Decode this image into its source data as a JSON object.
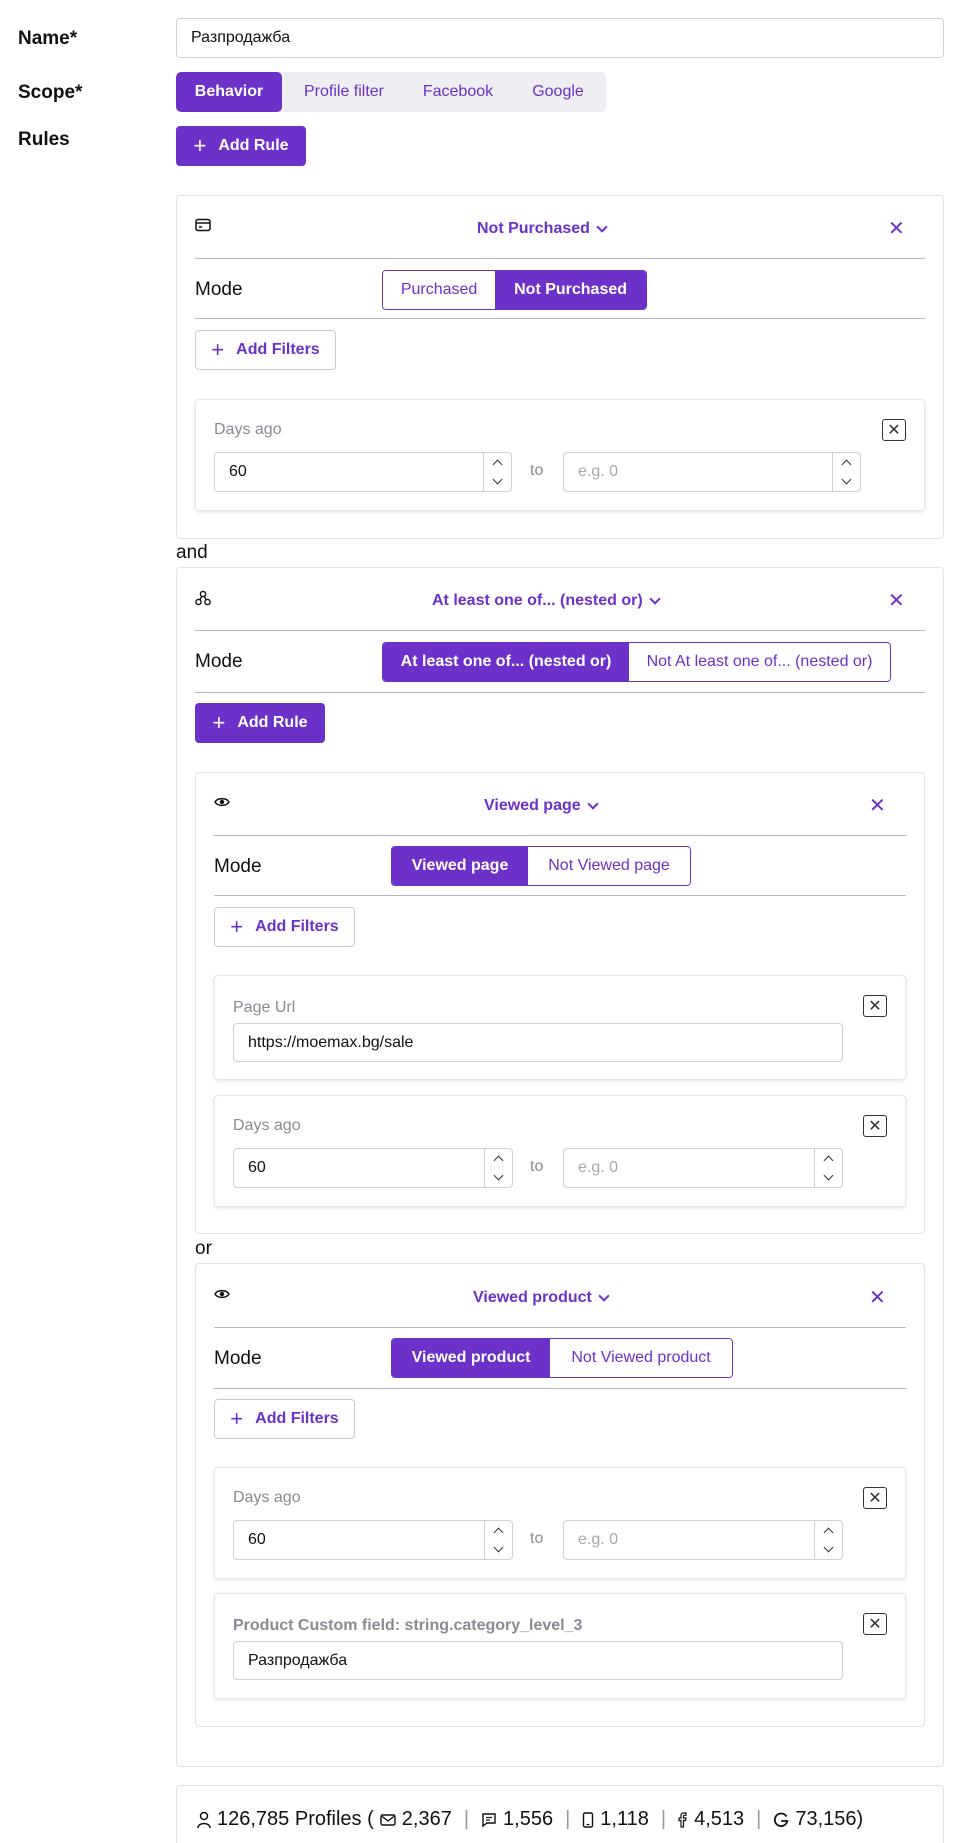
{
  "form": {
    "name_label": "Name*",
    "name_value": "Разпродажба",
    "scope_label": "Scope*",
    "scope_tabs": [
      "Behavior",
      "Profile filter",
      "Facebook",
      "Google"
    ],
    "scope_active": "Behavior",
    "rules_label": "Rules",
    "add_rule_label": "Add Rule"
  },
  "rule1": {
    "icon": "credit-card-icon",
    "title": "Not Purchased",
    "mode_label": "Mode",
    "mode_options": [
      "Purchased",
      "Not Purchased"
    ],
    "mode_active": "Not Purchased",
    "add_filters_label": "Add Filters",
    "filter_days": {
      "label": "Days ago",
      "from": "60",
      "to_label": "to",
      "to_placeholder": "e.g. 0"
    }
  },
  "joiner_and": "and",
  "rule2": {
    "icon": "nodes-icon",
    "title": "At least one of... (nested or)",
    "mode_label": "Mode",
    "mode_options": [
      "At least one of... (nested or)",
      "Not At least one of... (nested or)"
    ],
    "mode_active": "At least one of... (nested or)",
    "add_rule_label": "Add Rule",
    "nested": [
      {
        "icon": "eye-icon",
        "title": "Viewed page",
        "mode_label": "Mode",
        "mode_options": [
          "Viewed page",
          "Not Viewed page"
        ],
        "mode_active": "Viewed page",
        "add_filters_label": "Add Filters",
        "filter_url": {
          "label": "Page Url",
          "value": "https://moemax.bg/sale"
        },
        "filter_days": {
          "label": "Days ago",
          "from": "60",
          "to_label": "to",
          "to_placeholder": "e.g. 0"
        }
      },
      {
        "icon": "eye-icon",
        "title": "Viewed product",
        "mode_label": "Mode",
        "mode_options": [
          "Viewed product",
          "Not Viewed product"
        ],
        "mode_active": "Viewed product",
        "add_filters_label": "Add Filters",
        "filter_days": {
          "label": "Days ago",
          "from": "60",
          "to_label": "to",
          "to_placeholder": "e.g. 0"
        },
        "filter_custom": {
          "label": "Product Custom field: string.category_level_3",
          "value": "Разпродажба"
        }
      }
    ],
    "joiner_or": "or"
  },
  "stats": {
    "profiles": "126,785 Profiles (",
    "email": "2,367",
    "sms": "1,556",
    "mobile": "1,118",
    "facebook": "4,513",
    "google": "73,156)"
  },
  "colors": {
    "accent": "#6c31c9",
    "border": "#cfcfd6"
  }
}
